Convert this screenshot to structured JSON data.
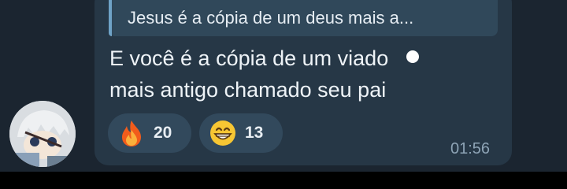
{
  "reply": {
    "text": "Jesus é a cópia de um deus mais a..."
  },
  "message": {
    "line1": "E você é a cópia de um viado",
    "line2": "mais antigo chamado seu pai",
    "time": "01:56"
  },
  "reactions": [
    {
      "icon": "fire-icon",
      "count": "20"
    },
    {
      "icon": "grinning-face-icon",
      "count": "13"
    }
  ],
  "colors": {
    "background": "#1b2530",
    "bubble": "#263746",
    "reply_accent": "#6fa3c7",
    "reaction_pill": "#32495c"
  }
}
